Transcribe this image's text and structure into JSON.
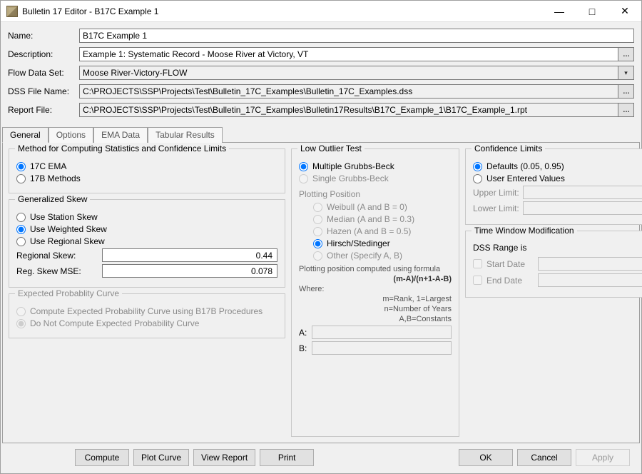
{
  "window": {
    "title": "Bulletin 17 Editor - B17C Example 1"
  },
  "form": {
    "name_label": "Name:",
    "name_value": "B17C Example 1",
    "description_label": "Description:",
    "description_value": "Example 1: Systematic Record - Moose River at Victory, VT",
    "flowdata_label": "Flow Data Set:",
    "flowdata_value": "Moose River-Victory-FLOW",
    "dssfile_label": "DSS File Name:",
    "dssfile_value": "C:\\PROJECTS\\SSP\\Projects\\Test\\Bulletin_17C_Examples\\Bulletin_17C_Examples.dss",
    "reportfile_label": "Report File:",
    "reportfile_value": "C:\\PROJECTS\\SSP\\Projects\\Test\\Bulletin_17C_Examples\\Bulletin17Results\\B17C_Example_1\\B17C_Example_1.rpt"
  },
  "tabs": [
    "General",
    "Options",
    "EMA Data",
    "Tabular Results"
  ],
  "method_group": {
    "legend": "Method for Computing Statistics and Confidence Limits",
    "ema": "17C EMA",
    "b17b": "17B Methods"
  },
  "skew_group": {
    "legend": "Generalized Skew",
    "station": "Use Station Skew",
    "weighted": "Use Weighted Skew",
    "regional": "Use Regional Skew",
    "reg_skew_label": "Regional Skew:",
    "reg_skew_value": "0.44",
    "reg_mse_label": "Reg. Skew MSE:",
    "reg_mse_value": "0.078"
  },
  "exp_group": {
    "legend": "Expected Probablity Curve",
    "compute": "Compute Expected Probability Curve using B17B Procedures",
    "dont": "Do Not Compute Expected Probability Curve"
  },
  "outlier_group": {
    "legend": "Low Outlier Test",
    "multi": "Multiple Grubbs-Beck",
    "single": "Single Grubbs-Beck"
  },
  "plotting": {
    "head": "Plotting Position",
    "weibull": "Weibull (A and B = 0)",
    "median": "Median (A and B = 0.3)",
    "hazen": "Hazen (A and B = 0.5)",
    "hirsch": "Hirsch/Stedinger",
    "other": "Other (Specify A, B)",
    "formula_line1": "Plotting position computed using formula",
    "formula_line2": "(m-A)/(n+1-A-B)",
    "where": "Where:",
    "m": "m=Rank, 1=Largest",
    "n": "n=Number of Years",
    "ab": "A,B=Constants",
    "a_label": "A:",
    "b_label": "B:"
  },
  "conf_group": {
    "legend": "Confidence Limits",
    "defaults": "Defaults (0.05, 0.95)",
    "user": "User Entered Values",
    "upper": "Upper Limit:",
    "lower": "Lower Limit:"
  },
  "timewin": {
    "legend": "Time Window Modification",
    "range_is": "DSS Range is",
    "start": "Start Date",
    "end": "End Date"
  },
  "buttons": {
    "compute": "Compute",
    "plot": "Plot Curve",
    "view": "View Report",
    "print": "Print",
    "ok": "OK",
    "cancel": "Cancel",
    "apply": "Apply"
  }
}
